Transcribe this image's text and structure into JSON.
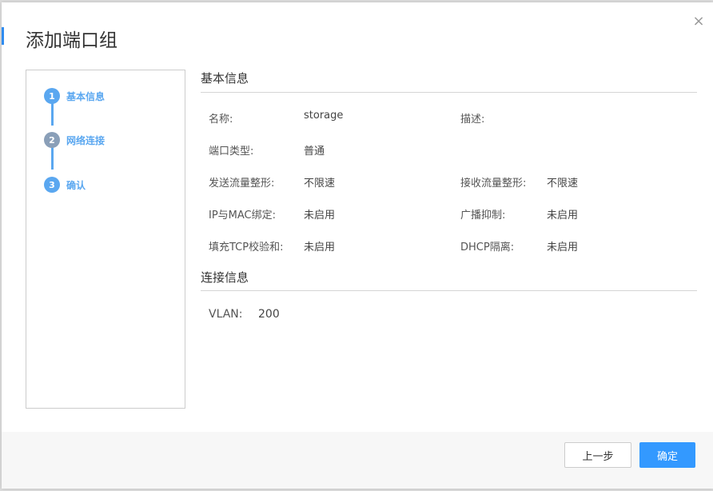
{
  "dialog": {
    "title": "添加端口组",
    "close_icon": "close-icon"
  },
  "steps": [
    {
      "num": "1",
      "label": "基本信息",
      "color": "#5aa7f0"
    },
    {
      "num": "2",
      "label": "网络连接",
      "color": "#8a9fb8"
    },
    {
      "num": "3",
      "label": "确认",
      "color": "#5aa7f0"
    }
  ],
  "basic_info": {
    "title": "基本信息",
    "fields": [
      {
        "label": "名称:",
        "value": "storage"
      },
      {
        "label": "描述:",
        "value": ""
      },
      {
        "label": "端口类型:",
        "value": "普通"
      },
      {
        "label": "发送流量整形:",
        "value": "不限速"
      },
      {
        "label": "接收流量整形:",
        "value": "不限速"
      },
      {
        "label": "IP与MAC绑定:",
        "value": "未启用"
      },
      {
        "label": "广播抑制:",
        "value": "未启用"
      },
      {
        "label": "填充TCP校验和:",
        "value": "未启用"
      },
      {
        "label": "DHCP隔离:",
        "value": "未启用"
      }
    ]
  },
  "connection_info": {
    "title": "连接信息",
    "vlan_label": "VLAN:",
    "vlan_value": "200"
  },
  "footer": {
    "prev_label": "上一步",
    "ok_label": "确定"
  },
  "colors": {
    "accent": "#2f8cf0",
    "primary_button": "#3399ff"
  }
}
